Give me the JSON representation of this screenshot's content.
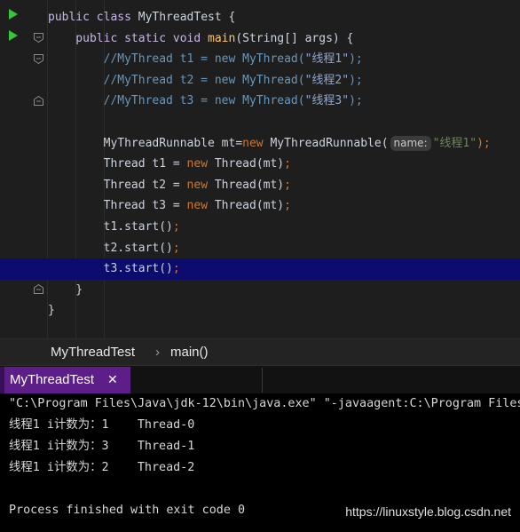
{
  "editor": {
    "lines": [
      {
        "segments": [
          {
            "t": "public class ",
            "c": "pkw"
          },
          {
            "t": "MyThreadTest {",
            "c": ""
          }
        ]
      },
      {
        "segments": [
          {
            "t": "    public static void ",
            "c": "pkw"
          },
          {
            "t": "main",
            "c": "fn"
          },
          {
            "t": "(String[] args) {",
            "c": ""
          }
        ]
      },
      {
        "segments": [
          {
            "t": "        //MyThread t1 = new MyThread(",
            "c": "cm"
          },
          {
            "t": "\"线程1\"",
            "c": "str-cm"
          },
          {
            "t": ");",
            "c": "cm"
          }
        ]
      },
      {
        "segments": [
          {
            "t": "        //MyThread t2 = new MyThread(",
            "c": "cm"
          },
          {
            "t": "\"线程2\"",
            "c": "str-cm"
          },
          {
            "t": ");",
            "c": "cm"
          }
        ]
      },
      {
        "segments": [
          {
            "t": "        //MyThread t3 = new MyThread(",
            "c": "cm"
          },
          {
            "t": "\"线程3\"",
            "c": "str-cm"
          },
          {
            "t": ");",
            "c": "cm"
          }
        ]
      },
      {
        "segments": []
      },
      {
        "segments": [
          {
            "t": "        MyThreadRunnable mt=",
            "c": ""
          },
          {
            "t": "new ",
            "c": "kw"
          },
          {
            "t": "MyThreadRunnable(",
            "c": ""
          },
          {
            "hint": "name:"
          },
          {
            "t": "\"线程1\"",
            "c": "str"
          },
          {
            "t": ");",
            "c": "semi"
          }
        ]
      },
      {
        "segments": [
          {
            "t": "        Thread t1 = ",
            "c": ""
          },
          {
            "t": "new ",
            "c": "kw"
          },
          {
            "t": "Thread(mt)",
            "c": ""
          },
          {
            "t": ";",
            "c": "semi"
          }
        ]
      },
      {
        "segments": [
          {
            "t": "        Thread t2 = ",
            "c": ""
          },
          {
            "t": "new ",
            "c": "kw"
          },
          {
            "t": "Thread(mt)",
            "c": ""
          },
          {
            "t": ";",
            "c": "semi"
          }
        ]
      },
      {
        "segments": [
          {
            "t": "        Thread t3 = ",
            "c": ""
          },
          {
            "t": "new ",
            "c": "kw"
          },
          {
            "t": "Thread(mt)",
            "c": ""
          },
          {
            "t": ";",
            "c": "semi"
          }
        ]
      },
      {
        "segments": [
          {
            "t": "        t1.start()",
            "c": ""
          },
          {
            "t": ";",
            "c": "semi"
          }
        ]
      },
      {
        "segments": [
          {
            "t": "        t2.start()",
            "c": ""
          },
          {
            "t": ";",
            "c": "semi"
          }
        ]
      },
      {
        "segments": [
          {
            "t": "        t3.start()",
            "c": ""
          },
          {
            "t": ";",
            "c": "semi"
          }
        ],
        "highlight": true
      },
      {
        "segments": [
          {
            "t": "    }",
            "c": ""
          }
        ]
      },
      {
        "segments": [
          {
            "t": "}",
            "c": ""
          }
        ]
      }
    ]
  },
  "breadcrumb": {
    "items": [
      "MyThreadTest",
      "main()"
    ],
    "separator": "›"
  },
  "run_tab": {
    "label": "MyThreadTest",
    "close": "✕"
  },
  "console": {
    "lines": [
      "\"C:\\Program Files\\Java\\jdk-12\\bin\\java.exe\" \"-javaagent:C:\\Program Files",
      "线程1 i计数为：1    Thread-0",
      "线程1 i计数为：3    Thread-1",
      "线程1 i计数为：2    Thread-2",
      "",
      "Process finished with exit code 0"
    ]
  },
  "watermark": "https://linuxstyle.blog.csdn.net",
  "colors": {
    "run_arrow": "#39c43b",
    "highlight_line": "#0c0c6e",
    "run_tab_bg": "#5e1e8a"
  }
}
